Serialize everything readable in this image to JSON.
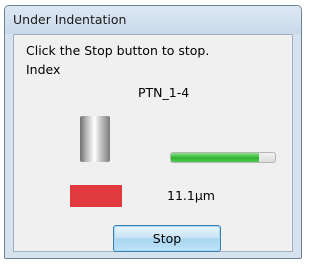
{
  "window": {
    "title": "Under Indentation"
  },
  "dialog": {
    "message": "Click the Stop button to stop.",
    "index_label": "Index",
    "index_value": "PTN_1-4",
    "progress": 0.85,
    "measurement": "11.1μm",
    "stop_label": "Stop"
  },
  "colors": {
    "base_red": "#e03a3f",
    "progress_green": "#2fb230",
    "button_border": "#3c7fb1"
  }
}
